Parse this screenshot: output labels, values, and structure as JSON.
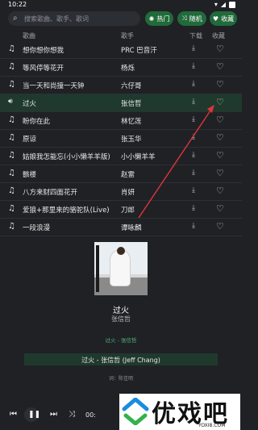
{
  "status": {
    "time": "10:22"
  },
  "search": {
    "placeholder": "搜索歌曲、歌手、歌词"
  },
  "filters": [
    {
      "label": "热门",
      "icon": "fire-icon"
    },
    {
      "label": "随机",
      "icon": "shuffle-icon"
    },
    {
      "label": "收藏",
      "icon": "heart-icon"
    }
  ],
  "table": {
    "headers": {
      "song": "歌曲",
      "artist": "歌手",
      "download": "下载",
      "favorite": "收藏"
    },
    "rows": [
      {
        "song": "想你想你想我",
        "artist": "PRC 巴音汗"
      },
      {
        "song": "等风停等花开",
        "artist": "杨烁"
      },
      {
        "song": "当一天和尚撞一天钟",
        "artist": "六仔哥"
      },
      {
        "song": "过火",
        "artist": "张信哲"
      },
      {
        "song": "盼你在此",
        "artist": "林忆莲"
      },
      {
        "song": "原谅",
        "artist": "张玉华"
      },
      {
        "song": "姑娘我怎能忘(小小懒羊羊版)",
        "artist": "小小懒羊羊"
      },
      {
        "song": "骸楼",
        "artist": "赵雷"
      },
      {
        "song": "八方来财四面花开",
        "artist": "肖妍"
      },
      {
        "song": "爱狼+那里来的骆驼队(Live)",
        "artist": "刀郎"
      },
      {
        "song": "一段浪漫",
        "artist": "谭咏麟"
      }
    ],
    "active_index": 3
  },
  "now_playing": {
    "title": "过火",
    "artist": "张信哲",
    "small_label": "过火 - 张信哲",
    "lyric_line": "过火 - 张信哲 (Jeff Chang)",
    "lyric_credit": "词：陈佳明"
  },
  "controls": {
    "time": "00:"
  },
  "watermark": {
    "text": "优戏吧",
    "url": "YOXI8.COM"
  },
  "colors": {
    "accent": "#216a3a",
    "active_row": "#1f3a2c",
    "arrow": "#e0343a"
  }
}
